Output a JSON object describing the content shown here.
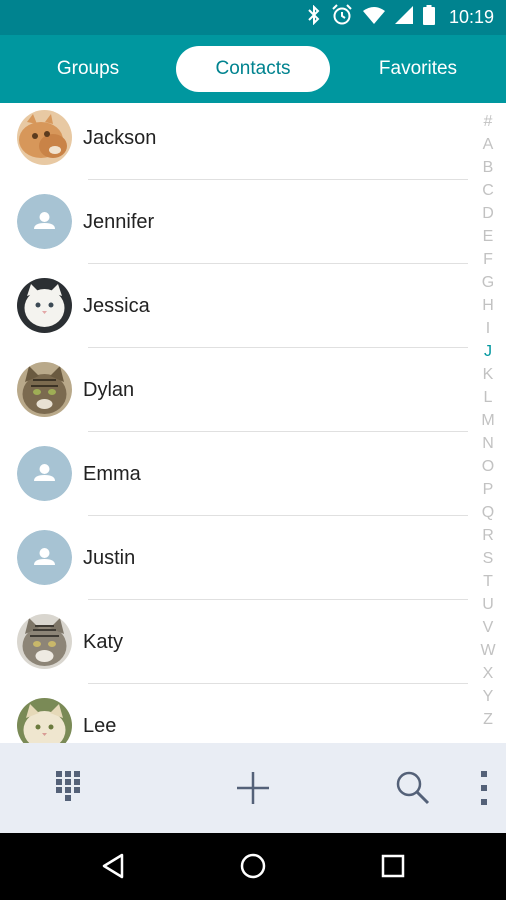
{
  "status_bar": {
    "time": "10:19",
    "icons": [
      "bluetooth-icon",
      "alarm-icon",
      "wifi-icon",
      "cellular-signal-icon",
      "battery-icon"
    ]
  },
  "tabs": [
    {
      "label": "Groups",
      "active": false
    },
    {
      "label": "Contacts",
      "active": true
    },
    {
      "label": "Favorites",
      "active": false
    }
  ],
  "contacts": [
    {
      "name": "Jackson",
      "avatar": "orange-cat-photo"
    },
    {
      "name": "Jennifer",
      "avatar": "default-person-icon"
    },
    {
      "name": "Jessica",
      "avatar": "white-persian-cat-photo"
    },
    {
      "name": "Dylan",
      "avatar": "tabby-cat-photo"
    },
    {
      "name": "Emma",
      "avatar": "default-person-icon"
    },
    {
      "name": "Justin",
      "avatar": "default-person-icon"
    },
    {
      "name": "Katy",
      "avatar": "gray-tabby-cat-photo"
    },
    {
      "name": "Lee",
      "avatar": "cream-cat-photo"
    }
  ],
  "index_letters": [
    "#",
    "A",
    "B",
    "C",
    "D",
    "E",
    "F",
    "G",
    "H",
    "I",
    "J",
    "K",
    "L",
    "M",
    "N",
    "O",
    "P",
    "Q",
    "R",
    "S",
    "T",
    "U",
    "V",
    "W",
    "X",
    "Y",
    "Z"
  ],
  "active_index_letter": "J",
  "bottom_toolbar": [
    "dialpad-icon",
    "add-icon",
    "search-icon",
    "more-vert-icon"
  ],
  "nav_bar": [
    "back-icon",
    "home-icon",
    "recents-icon"
  ],
  "colors": {
    "status_bar": "#00838f",
    "tab_bar": "#00979f",
    "accent": "#00979f",
    "default_avatar": "#a7c3d3",
    "toolbar_bg": "#e9edf4",
    "toolbar_icon": "#546178"
  }
}
